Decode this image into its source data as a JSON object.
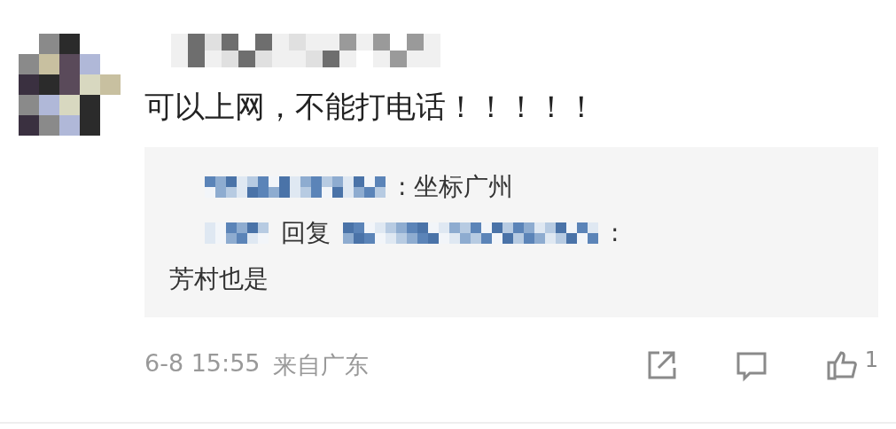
{
  "comment": {
    "text": "可以上网，不能打电话！！！！！",
    "replies": [
      {
        "after_name": ": 坐标广州"
      },
      {
        "verb": "回复",
        "after_name": ":",
        "text": "芳村也是"
      }
    ]
  },
  "footer": {
    "time": "6-8 15:55",
    "location": "来自广东",
    "like_count": "1"
  }
}
